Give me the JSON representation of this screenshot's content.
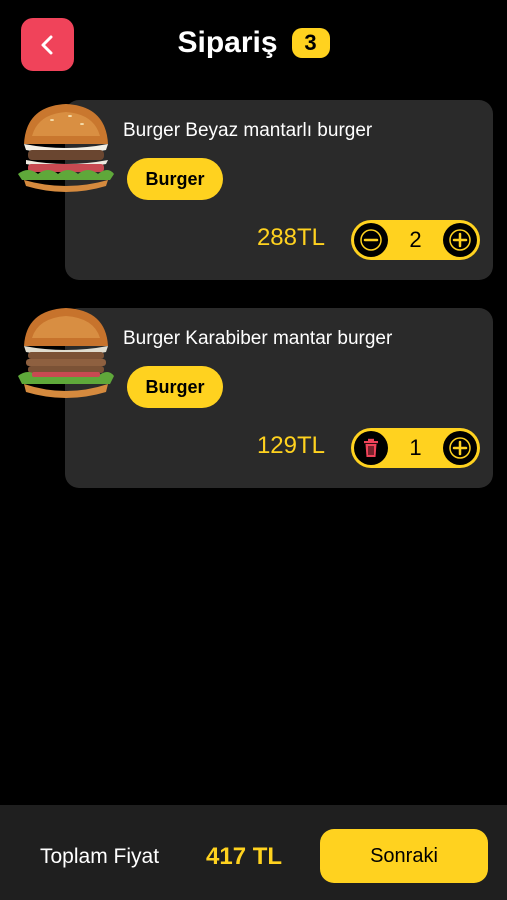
{
  "header": {
    "title": "Sipariş",
    "count": "3",
    "back_icon": "chevron-left-icon"
  },
  "colors": {
    "accent": "#ffd21f",
    "back_button": "#f0435a",
    "card": "#2a2a2a",
    "background": "#000000",
    "delete_icon": "#f0435a"
  },
  "items": [
    {
      "name": "Burger Beyaz mantarlı burger",
      "category": "Burger",
      "price": "288TL",
      "quantity": "2",
      "decrease_icon": "minus-icon",
      "increase_icon": "plus-icon"
    },
    {
      "name": "Burger Karabiber mantar burger",
      "category": "Burger",
      "price": "129TL",
      "quantity": "1",
      "decrease_icon": "trash-icon",
      "increase_icon": "plus-icon"
    }
  ],
  "footer": {
    "total_label": "Toplam Fiyat",
    "total_value": "417 TL",
    "next_label": "Sonraki"
  }
}
